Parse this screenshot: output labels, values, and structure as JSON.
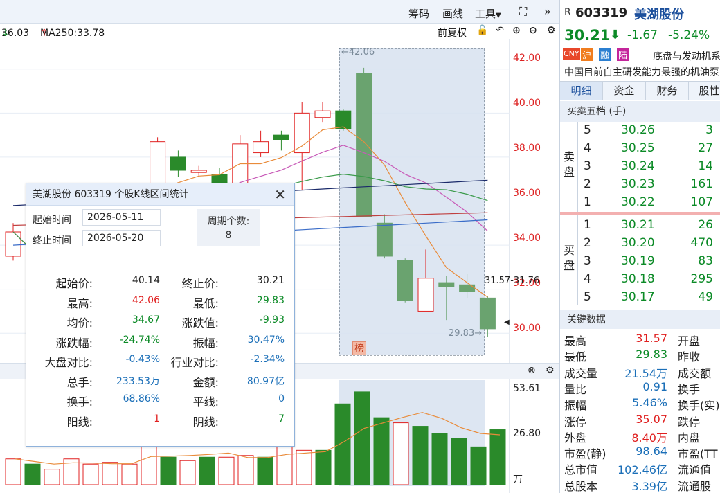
{
  "toolbar": {
    "chips": "筹码",
    "draw": "画线",
    "tools": "工具",
    "restore": "前复权"
  },
  "ma_bar": {
    "ma_prev": "36.03",
    "ma250": "MA250:33.78"
  },
  "price_axis": [
    "42.00",
    "40.00",
    "38.00",
    "36.00",
    "34.00",
    "32.00",
    "30.00"
  ],
  "annotations": {
    "high": "←42.06",
    "low": "29.83→",
    "hl": "31.57-31.76",
    "bang": "榜"
  },
  "volume_axis": [
    "53.61",
    "26.80",
    "万"
  ],
  "chart_data": {
    "type": "candlestick",
    "ylim": [
      29.0,
      43.0
    ],
    "candles": [
      {
        "o": 33.5,
        "c": 34.6,
        "h": 35.0,
        "l": 33.3
      },
      {
        "o": 33.0,
        "c": 32.8,
        "h": 33.4,
        "l": 32.5
      },
      {
        "o": 35.7,
        "c": 35.9,
        "h": 36.4,
        "l": 35.0
      },
      {
        "o": 35.9,
        "c": 36.0,
        "h": 36.2,
        "l": 35.5
      },
      {
        "o": 35.7,
        "c": 35.9,
        "h": 36.0,
        "l": 35.4
      },
      {
        "o": 35.8,
        "c": 36.1,
        "h": 36.3,
        "l": 35.4
      },
      {
        "o": 35.9,
        "c": 36.1,
        "h": 36.3,
        "l": 35.6
      },
      {
        "o": 36.0,
        "c": 38.7,
        "h": 38.9,
        "l": 35.9
      },
      {
        "o": 38.0,
        "c": 37.4,
        "h": 38.3,
        "l": 37.1
      },
      {
        "o": 37.3,
        "c": 37.4,
        "h": 37.6,
        "l": 37.1
      },
      {
        "o": 37.2,
        "c": 36.4,
        "h": 37.5,
        "l": 36.1
      },
      {
        "o": 36.6,
        "c": 38.6,
        "h": 39.0,
        "l": 36.5
      },
      {
        "o": 38.2,
        "c": 38.7,
        "h": 39.2,
        "l": 38.0
      },
      {
        "o": 39.0,
        "c": 38.8,
        "h": 39.2,
        "l": 38.3
      },
      {
        "o": 38.2,
        "c": 40.0,
        "h": 40.5,
        "l": 36.5
      },
      {
        "o": 39.8,
        "c": 40.1,
        "h": 40.5,
        "l": 39.6
      },
      {
        "o": 40.1,
        "c": 39.3,
        "h": 40.2,
        "l": 39.2
      },
      {
        "o": 41.8,
        "c": 35.3,
        "h": 42.06,
        "l": 35.3
      },
      {
        "o": 35.0,
        "c": 33.5,
        "h": 35.4,
        "l": 33.4
      },
      {
        "o": 33.3,
        "c": 31.5,
        "h": 33.4,
        "l": 31.4
      },
      {
        "o": 31.0,
        "c": 32.5,
        "h": 33.8,
        "l": 31.0
      },
      {
        "o": 32.3,
        "c": 32.1,
        "h": 32.6,
        "l": 30.6
      },
      {
        "o": 32.2,
        "c": 31.9,
        "h": 32.7,
        "l": 31.6
      },
      {
        "o": 31.6,
        "c": 30.2,
        "h": 31.7,
        "l": 29.83
      }
    ],
    "volume": [
      15,
      12,
      9,
      15,
      12,
      13,
      12,
      30,
      16,
      14,
      16,
      16,
      17,
      16,
      23,
      20,
      20,
      47,
      54,
      39,
      36,
      34,
      30,
      27,
      22,
      32
    ],
    "ma_lines": [
      {
        "name": "MA5",
        "color": "#e98b3a"
      },
      {
        "name": "MA10",
        "color": "#c85ab8"
      },
      {
        "name": "MA20",
        "color": "#3a9a4a"
      },
      {
        "name": "MA30",
        "color": "#3a6cc8"
      },
      {
        "name": "MA60",
        "color": "#c04040"
      },
      {
        "name": "MA120",
        "color": "#1a2a6a"
      }
    ]
  },
  "popup": {
    "title": "美湖股份  603319  个股K线区间统计",
    "start_label": "起始时间",
    "start_value": "2026-05-11",
    "end_label": "终止时间",
    "end_value": "2026-05-20",
    "period_label": "周期个数:",
    "period_value": "8",
    "stats_left": [
      {
        "label": "起始价:",
        "value": "40.14",
        "color": "blk"
      },
      {
        "label": "最高:",
        "value": "42.06",
        "color": "red"
      },
      {
        "label": "均价:",
        "value": "34.67",
        "color": "grn"
      },
      {
        "label": "涨跌幅:",
        "value": "-24.74%",
        "color": "grn"
      },
      {
        "label": "大盘对比:",
        "value": "-0.43%",
        "color": "blu"
      },
      {
        "label": "总手:",
        "value": "233.53万",
        "color": "blu"
      },
      {
        "label": "换手:",
        "value": "68.86%",
        "color": "blu"
      },
      {
        "label": "阳线:",
        "value": "1",
        "color": "red"
      }
    ],
    "stats_right": [
      {
        "label": "终止价:",
        "value": "30.21",
        "color": "blk"
      },
      {
        "label": "最低:",
        "value": "29.83",
        "color": "grn"
      },
      {
        "label": "涨跌值:",
        "value": "-9.93",
        "color": "grn"
      },
      {
        "label": "振幅:",
        "value": "30.47%",
        "color": "blu"
      },
      {
        "label": "行业对比:",
        "value": "-2.34%",
        "color": "blu"
      },
      {
        "label": "金额:",
        "value": "80.97亿",
        "color": "blu"
      },
      {
        "label": "平线:",
        "value": "0",
        "color": "blu"
      },
      {
        "label": "阴线:",
        "value": "7",
        "color": "grn"
      }
    ]
  },
  "quote": {
    "code": "603319",
    "name": "美湖股份",
    "r": "R",
    "price": "30.21",
    "change": "-1.67",
    "pct": "-5.24%",
    "tags": [
      "CNY",
      "沪",
      "融",
      "陆"
    ],
    "concept": "底盘与发动机系",
    "desc": "中国目前自主研发能力最强的机油泵"
  },
  "tabs": [
    "明细",
    "资金",
    "财务",
    "股性"
  ],
  "order_book": {
    "title": "买卖五档 (手)",
    "sell_label": "卖盘",
    "buy_label": "买盘",
    "sells": [
      {
        "lvl": "5",
        "price": "30.26",
        "vol": "3"
      },
      {
        "lvl": "4",
        "price": "30.25",
        "vol": "27"
      },
      {
        "lvl": "3",
        "price": "30.24",
        "vol": "14"
      },
      {
        "lvl": "2",
        "price": "30.23",
        "vol": "161"
      },
      {
        "lvl": "1",
        "price": "30.22",
        "vol": "107"
      }
    ],
    "buys": [
      {
        "lvl": "1",
        "price": "30.21",
        "vol": "26"
      },
      {
        "lvl": "2",
        "price": "30.20",
        "vol": "470"
      },
      {
        "lvl": "3",
        "price": "30.19",
        "vol": "83"
      },
      {
        "lvl": "4",
        "price": "30.18",
        "vol": "295"
      },
      {
        "lvl": "5",
        "price": "30.17",
        "vol": "49"
      }
    ]
  },
  "key_data": {
    "title": "关键数据",
    "rows": [
      {
        "l1": "最高",
        "v1": "31.57",
        "c1": "red",
        "l2": "开盘"
      },
      {
        "l1": "最低",
        "v1": "29.83",
        "c1": "grn",
        "l2": "昨收"
      },
      {
        "l1": "成交量",
        "v1": "21.54万",
        "c1": "blu",
        "l2": "成交额"
      },
      {
        "l1": "量比",
        "v1": "0.91",
        "c1": "blu",
        "l2": "换手"
      },
      {
        "l1": "振幅",
        "v1": "5.46%",
        "c1": "blu",
        "l2": "换手(实)"
      },
      {
        "l1": "涨停",
        "v1": "35.07",
        "c1": "red",
        "l2": "跌停"
      },
      {
        "l1": "外盘",
        "v1": "8.40万",
        "c1": "red",
        "l2": "内盘"
      },
      {
        "l1": "市盈(静)",
        "v1": "98.64",
        "c1": "blu",
        "l2": "市盈(TT"
      },
      {
        "l1": "总市值",
        "v1": "102.46亿",
        "c1": "blu",
        "l2": "流通值"
      },
      {
        "l1": "总股本",
        "v1": "3.39亿",
        "c1": "blu",
        "l2": "流通股"
      }
    ]
  }
}
